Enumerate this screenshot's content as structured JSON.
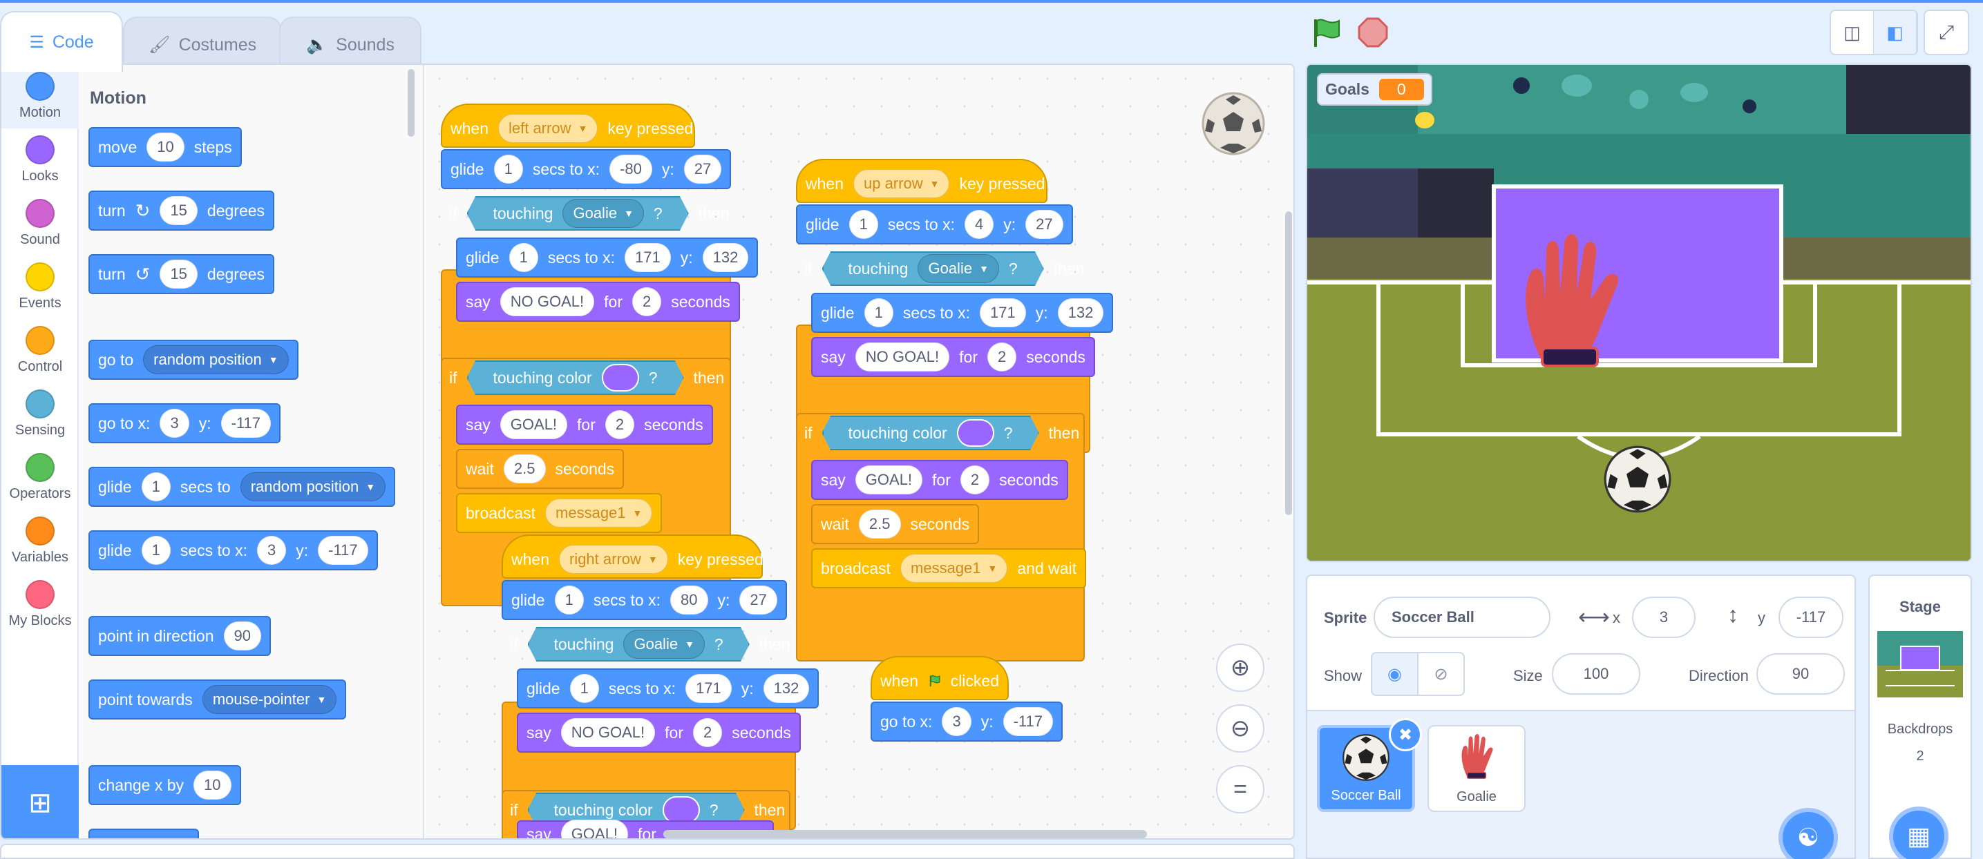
{
  "tabs": {
    "code": "Code",
    "costumes": "Costumes",
    "sounds": "Sounds"
  },
  "categories": [
    {
      "label": "Motion",
      "color": "#4c97ff"
    },
    {
      "label": "Looks",
      "color": "#9966ff"
    },
    {
      "label": "Sound",
      "color": "#cf63cf"
    },
    {
      "label": "Events",
      "color": "#ffd500"
    },
    {
      "label": "Control",
      "color": "#ffab19"
    },
    {
      "label": "Sensing",
      "color": "#5cb1d6"
    },
    {
      "label": "Operators",
      "color": "#59c059"
    },
    {
      "label": "Variables",
      "color": "#ff8c1a"
    },
    {
      "label": "My Blocks",
      "color": "#ff6680"
    }
  ],
  "palette": {
    "title": "Motion",
    "move": {
      "a": "move",
      "v": "10",
      "b": "steps"
    },
    "turn_right": {
      "a": "turn",
      "v": "15",
      "b": "degrees"
    },
    "turn_left": {
      "a": "turn",
      "v": "15",
      "b": "degrees"
    },
    "goto": {
      "a": "go to",
      "dd": "random position"
    },
    "goto_xy": {
      "a": "go to x:",
      "x": "3",
      "b": "y:",
      "y": "-117"
    },
    "glide_to": {
      "a": "glide",
      "v": "1",
      "b": "secs to",
      "dd": "random position"
    },
    "glide_xy": {
      "a": "glide",
      "v": "1",
      "b": "secs to x:",
      "x": "3",
      "c": "y:",
      "y": "-117"
    },
    "point_dir": {
      "a": "point in direction",
      "v": "90"
    },
    "point_towards": {
      "a": "point towards",
      "dd": "mouse-pointer"
    },
    "change_x": {
      "a": "change x by",
      "v": "10"
    }
  },
  "script1": {
    "when": "when",
    "key": "left arrow",
    "pressed": "key pressed",
    "glide1": {
      "a": "glide",
      "v": "1",
      "b": "secs to x:",
      "x": "-80",
      "c": "y:",
      "y": "27"
    },
    "if1": {
      "if": "if",
      "touching": "touching",
      "obj": "Goalie",
      "q": "?",
      "then": "then"
    },
    "glide2": {
      "a": "glide",
      "v": "1",
      "b": "secs to x:",
      "x": "171",
      "c": "y:",
      "y": "132"
    },
    "say1": {
      "a": "say",
      "msg": "NO GOAL!",
      "b": "for",
      "v": "2",
      "c": "seconds"
    },
    "if2": {
      "if": "if",
      "touching": "touching color",
      "q": "?",
      "then": "then"
    },
    "say2": {
      "a": "say",
      "msg": "GOAL!",
      "b": "for",
      "v": "2",
      "c": "seconds"
    },
    "wait": {
      "a": "wait",
      "v": "2.5",
      "b": "seconds"
    },
    "broadcast": {
      "a": "broadcast",
      "dd": "message1"
    }
  },
  "script2": {
    "when": "when",
    "key": "up arrow",
    "pressed": "key pressed",
    "glide1": {
      "a": "glide",
      "v": "1",
      "b": "secs to x:",
      "x": "4",
      "c": "y:",
      "y": "27"
    },
    "if1": {
      "if": "if",
      "touching": "touching",
      "obj": "Goalie",
      "q": "?",
      "then": "then"
    },
    "glide2": {
      "a": "glide",
      "v": "1",
      "b": "secs to x:",
      "x": "171",
      "c": "y:",
      "y": "132"
    },
    "say1": {
      "a": "say",
      "msg": "NO GOAL!",
      "b": "for",
      "v": "2",
      "c": "seconds"
    },
    "if2": {
      "if": "if",
      "touching": "touching color",
      "q": "?",
      "then": "then"
    },
    "say2": {
      "a": "say",
      "msg": "GOAL!",
      "b": "for",
      "v": "2",
      "c": "seconds"
    },
    "wait": {
      "a": "wait",
      "v": "2.5",
      "b": "seconds"
    },
    "broadcast": {
      "a": "broadcast",
      "dd": "message1",
      "b": "and wait"
    }
  },
  "script3": {
    "when": "when",
    "key": "right arrow",
    "pressed": "key pressed",
    "glide1": {
      "a": "glide",
      "v": "1",
      "b": "secs to x:",
      "x": "80",
      "c": "y:",
      "y": "27"
    },
    "if1": {
      "if": "if",
      "touching": "touching",
      "obj": "Goalie",
      "q": "?",
      "then": "then"
    },
    "glide2": {
      "a": "glide",
      "v": "1",
      "b": "secs to x:",
      "x": "171",
      "c": "y:",
      "y": "132"
    },
    "say1": {
      "a": "say",
      "msg": "NO GOAL!",
      "b": "for",
      "v": "2",
      "c": "seconds"
    },
    "if2": {
      "if": "if",
      "touching": "touching color",
      "q": "?",
      "then": "then"
    },
    "say2": {
      "a": "say",
      "msg": "GOAL!",
      "b": "for"
    }
  },
  "script4": {
    "when": "when",
    "clicked": "clicked",
    "goto": {
      "a": "go to x:",
      "x": "3",
      "b": "y:",
      "y": "-117"
    }
  },
  "stage": {
    "monitor_label": "Goals",
    "monitor_value": "0"
  },
  "sprite_info": {
    "sprite_label": "Sprite",
    "sprite_name": "Soccer Ball",
    "x_label": "x",
    "x": "3",
    "y_label": "y",
    "y": "-117",
    "show_label": "Show",
    "size_label": "Size",
    "size": "100",
    "direction_label": "Direction",
    "direction": "90"
  },
  "sprites": [
    {
      "name": "Soccer Ball"
    },
    {
      "name": "Goalie"
    }
  ],
  "stage_panel": {
    "title": "Stage",
    "backdrops_label": "Backdrops",
    "backdrops_count": "2"
  },
  "colors": {
    "accent": "#4c97ff",
    "motion": "#4c97ff",
    "looks": "#9966ff",
    "control": "#ffab19",
    "events": "#ffbf00",
    "sensing": "#5cb1d6",
    "goal_bg": "#9966ff"
  }
}
